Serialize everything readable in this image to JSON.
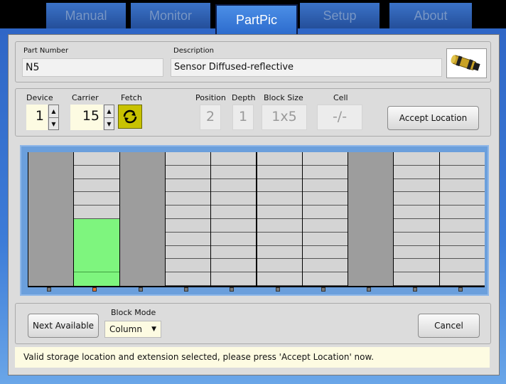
{
  "tabs": [
    "Manual",
    "Monitor",
    "PartPic",
    "Setup",
    "About"
  ],
  "active_tab": "PartPic",
  "part": {
    "number_label": "Part Number",
    "number_value": "N5",
    "description_label": "Description",
    "description_value": "Sensor Diffused-reflective",
    "image_icon": "sensor-part-icon"
  },
  "location": {
    "device_label": "Device",
    "device_value": "1",
    "carrier_label": "Carrier",
    "carrier_value": "15",
    "fetch_label": "Fetch",
    "fetch_icon": "refresh-icon",
    "position_label": "Position",
    "position_value": "2",
    "depth_label": "Depth",
    "depth_value": "1",
    "blocksize_label": "Block Size",
    "blocksize_value": "1x5",
    "cell_label": "Cell",
    "cell_value": "-/-",
    "accept_label": "Accept Location"
  },
  "grid": {
    "columns": [
      {
        "kind": "blocked",
        "led": "normal"
      },
      {
        "kind": "slots",
        "slots": 10,
        "selected_from": 5,
        "selected_to": 9,
        "led": "active"
      },
      {
        "kind": "blocked",
        "led": "normal"
      },
      {
        "kind": "slots",
        "slots": 10,
        "led": "normal"
      },
      {
        "kind": "slots",
        "slots": 10,
        "led": "normal"
      },
      {
        "kind": "slots",
        "slots": 10,
        "led": "normal"
      },
      {
        "kind": "slots",
        "slots": 10,
        "led": "normal"
      },
      {
        "kind": "blocked",
        "led": "normal"
      },
      {
        "kind": "slots",
        "slots": 10,
        "led": "normal"
      },
      {
        "kind": "slots",
        "slots": 10,
        "led": "normal"
      }
    ],
    "colors": {
      "slot": "#d4d4d4",
      "blocked": "#9d9d9d",
      "selected": "#7ef57e",
      "led_normal": "#7a7a7a",
      "led_active": "#e8732c"
    }
  },
  "bottom": {
    "next_label": "Next Available",
    "blockmode_label": "Block Mode",
    "blockmode_value": "Column",
    "cancel_label": "Cancel"
  },
  "status_text": "Valid storage location and extension selected, please press 'Accept Location' now."
}
